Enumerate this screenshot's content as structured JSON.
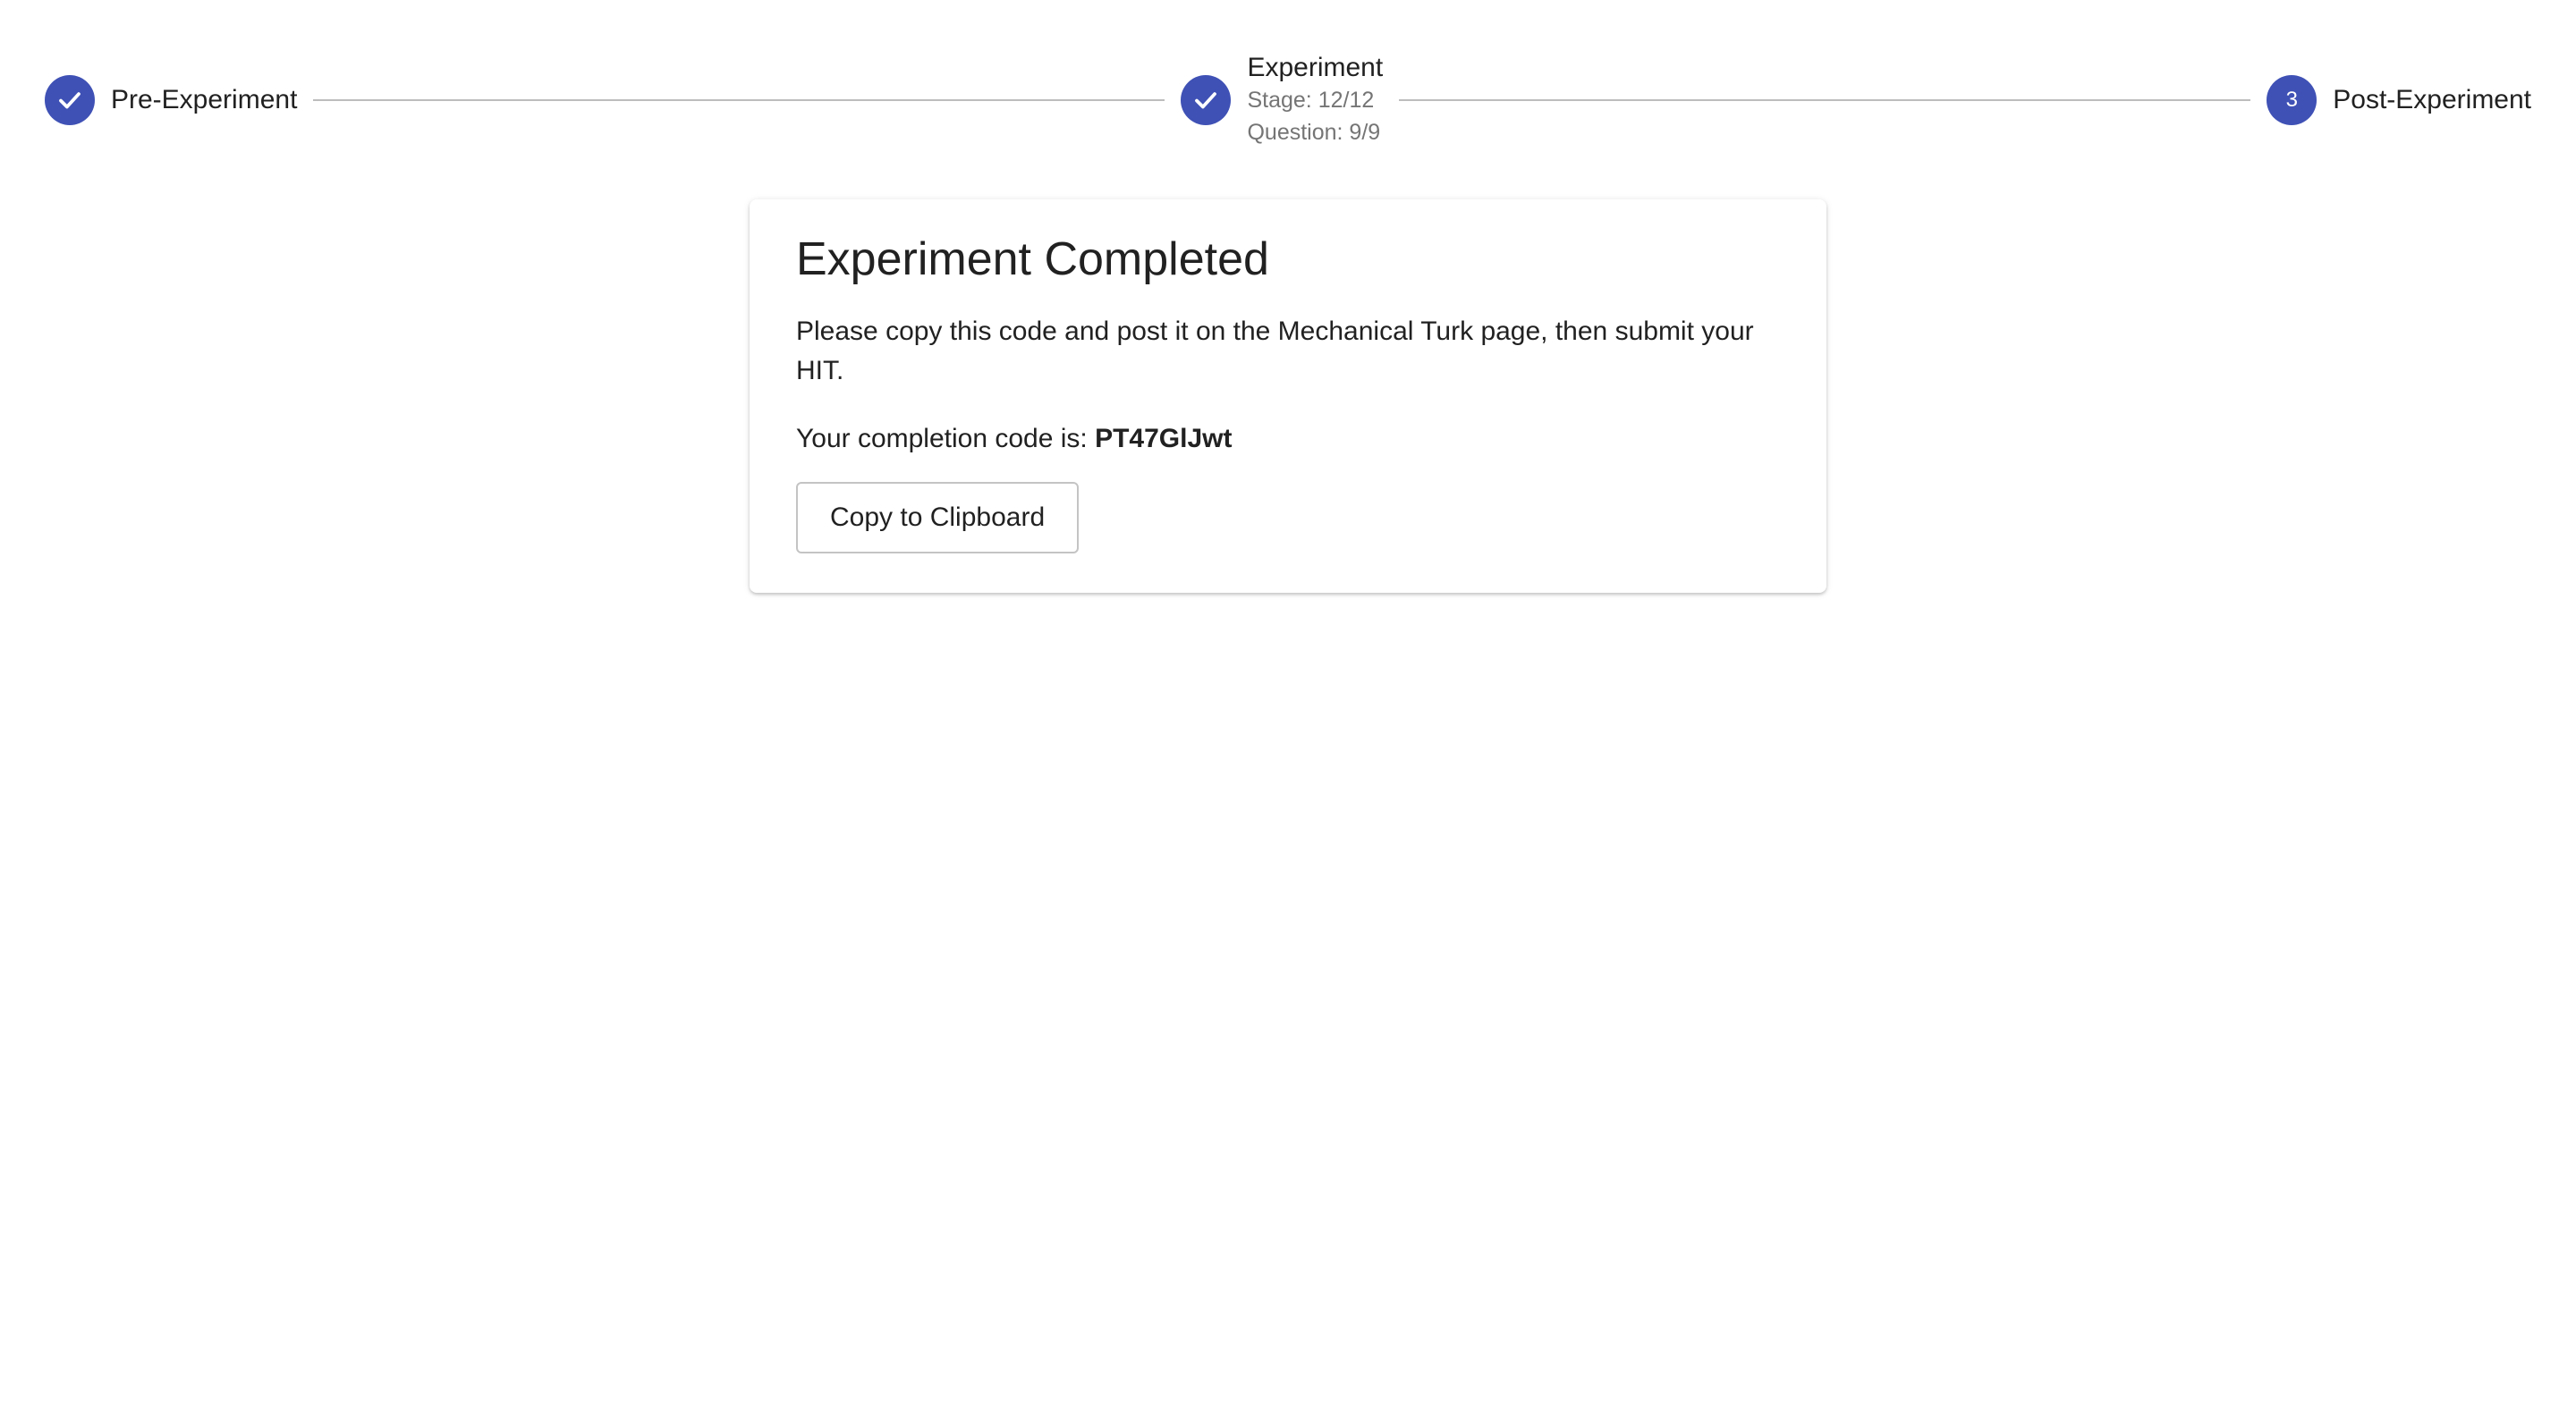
{
  "stepper": {
    "steps": [
      {
        "label": "Pre-Experiment",
        "status": "completed",
        "icon": "check-icon"
      },
      {
        "label": "Experiment",
        "status": "completed",
        "icon": "check-icon",
        "stage": "Stage: 12/12",
        "question": "Question: 9/9"
      },
      {
        "label": "Post-Experiment",
        "status": "active",
        "number": "3"
      }
    ],
    "accent_color": "#3f51b5"
  },
  "card": {
    "title": "Experiment Completed",
    "instructions": "Please copy this code and post it on the Mechanical Turk page, then submit your HIT.",
    "code_prefix": "Your completion code is: ",
    "code": "PT47GlJwt",
    "copy_button_label": "Copy to Clipboard"
  }
}
